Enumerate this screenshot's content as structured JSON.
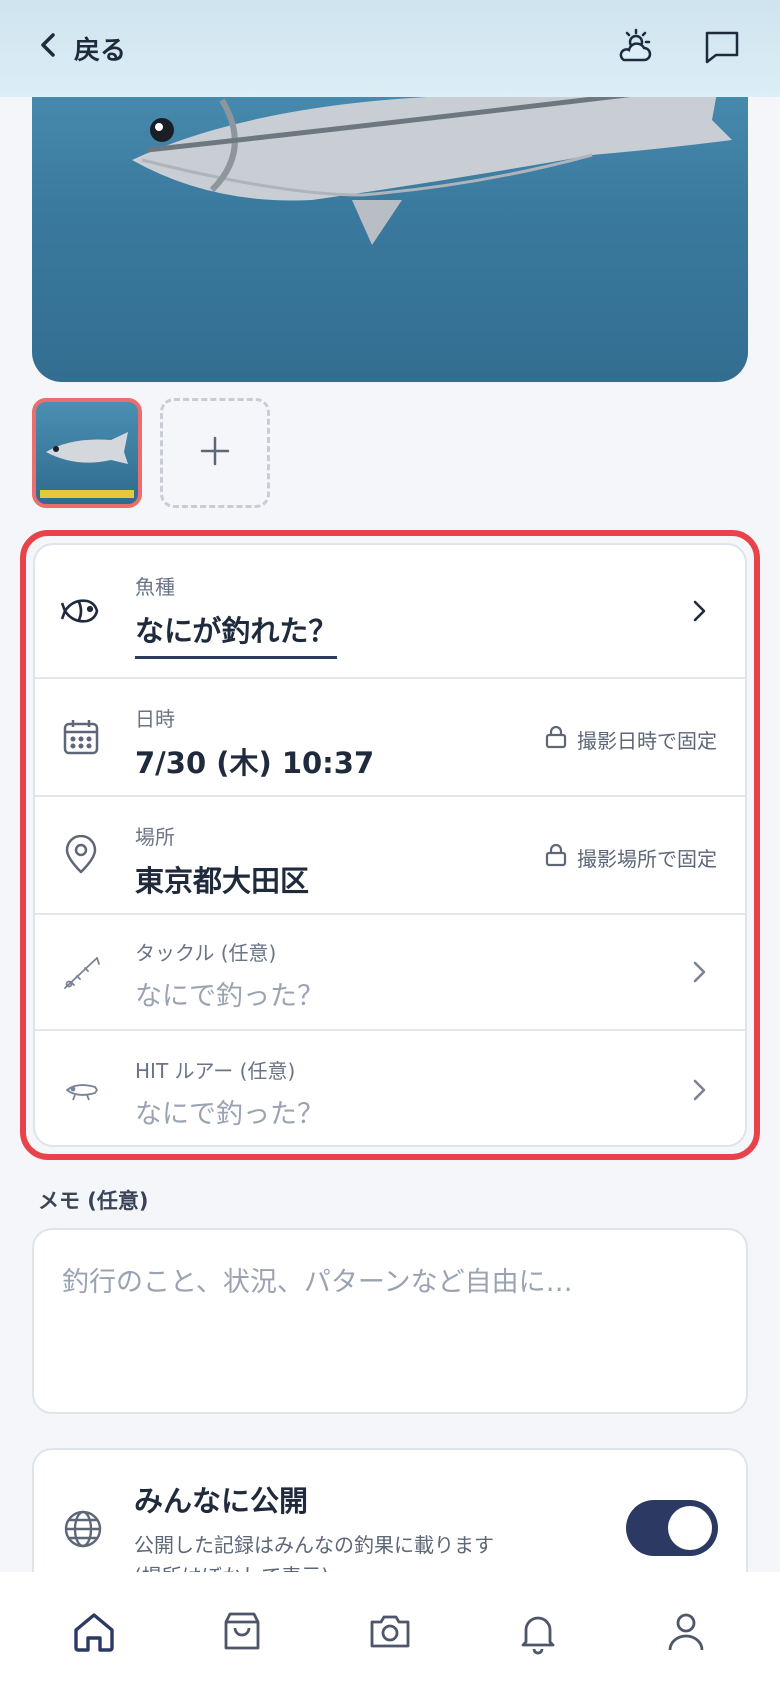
{
  "header": {
    "back_label": "戻る",
    "icons": [
      "weather-icon",
      "chat-icon"
    ]
  },
  "photos": {
    "thumbnails": 1,
    "add_icon": "plus-icon"
  },
  "form": {
    "species": {
      "label": "魚種",
      "value": "なにが釣れた？"
    },
    "datetime": {
      "label": "日時",
      "value": "7/30 (木) 10:37",
      "lock_text": "撮影日時で固定"
    },
    "place": {
      "label": "場所",
      "value": "東京都大田区",
      "lock_text": "撮影場所で固定"
    },
    "tackle": {
      "label": "タックル (任意)",
      "placeholder": "なにで釣った？"
    },
    "lure": {
      "label": "HIT ルアー (任意)",
      "placeholder": "なにで釣った？"
    }
  },
  "memo": {
    "label": "メモ (任意)",
    "placeholder": "釣行のこと、状況、パターンなど自由に…"
  },
  "public": {
    "title": "みんなに公開",
    "desc_line1": "公開した記録はみんなの釣果に載ります",
    "desc_line2": "(場所はぼかして表示)",
    "enabled": true
  },
  "colors": {
    "highlight": "#e8434a",
    "accent": "#2c3a63"
  },
  "nav": {
    "tabs": [
      "home-icon",
      "bag-icon",
      "camera-icon",
      "bell-icon",
      "user-icon"
    ],
    "active": "home-icon"
  }
}
